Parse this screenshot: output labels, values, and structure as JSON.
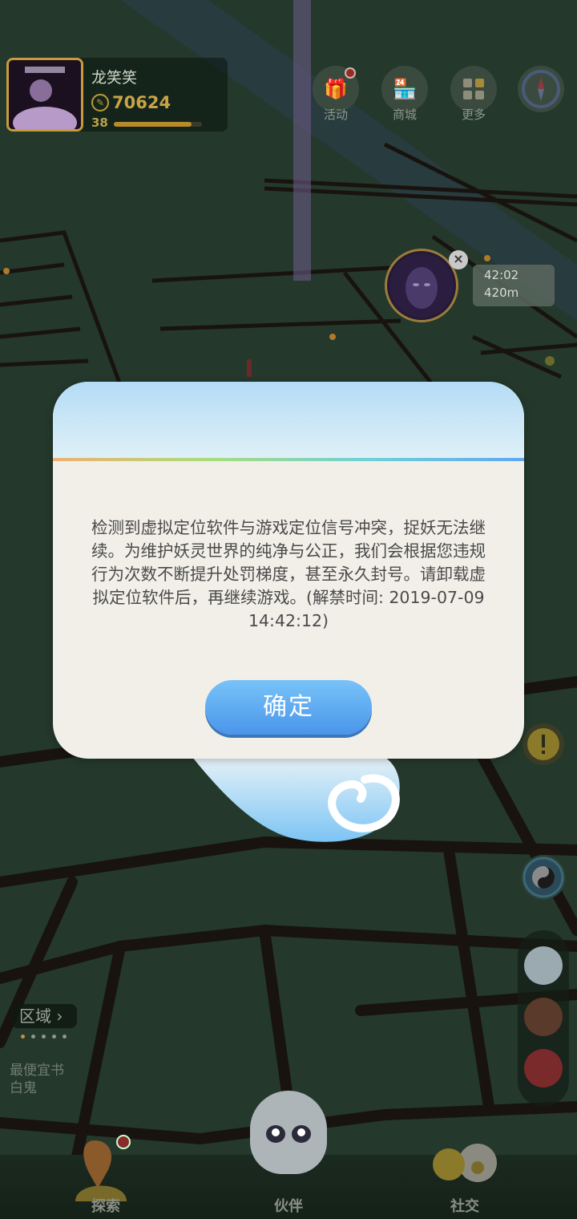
{
  "player": {
    "name": "龙笑笑",
    "coins": "70624",
    "level": "38",
    "xp_progress": 0.88
  },
  "top_menu": [
    {
      "label": "活动",
      "icon": "gift-icon",
      "has_badge": true
    },
    {
      "label": "商城",
      "icon": "shop-icon",
      "has_badge": false
    },
    {
      "label": "更多",
      "icon": "more-grid-icon",
      "has_badge": false
    },
    {
      "label": "",
      "icon": "compass-icon",
      "has_badge": false
    }
  ],
  "monster_timer": {
    "time": "42:02",
    "distance": "420m"
  },
  "area": {
    "tag": "区域",
    "line1": "最便宜书",
    "line2": "白鬼"
  },
  "bottom_nav": {
    "explore": "探索",
    "partner": "伙伴",
    "social": "社交"
  },
  "dialog": {
    "message": "检测到虚拟定位软件与游戏定位信号冲突，捉妖无法继续。为维护妖灵世界的纯净与公正，我们会根据您违规行为次数不断提升处罚梯度，甚至永久封号。请卸载虚拟定位软件后，再继续游戏。(解禁时间: 2019-07-09 14:42:12)",
    "confirm_label": "确定"
  },
  "colors": {
    "map_bg": "#24382c",
    "road": "#1a1614",
    "dialog_bg": "#f1efe8",
    "button_blue": "#4a95ea",
    "coin_gold": "#c9a447"
  }
}
